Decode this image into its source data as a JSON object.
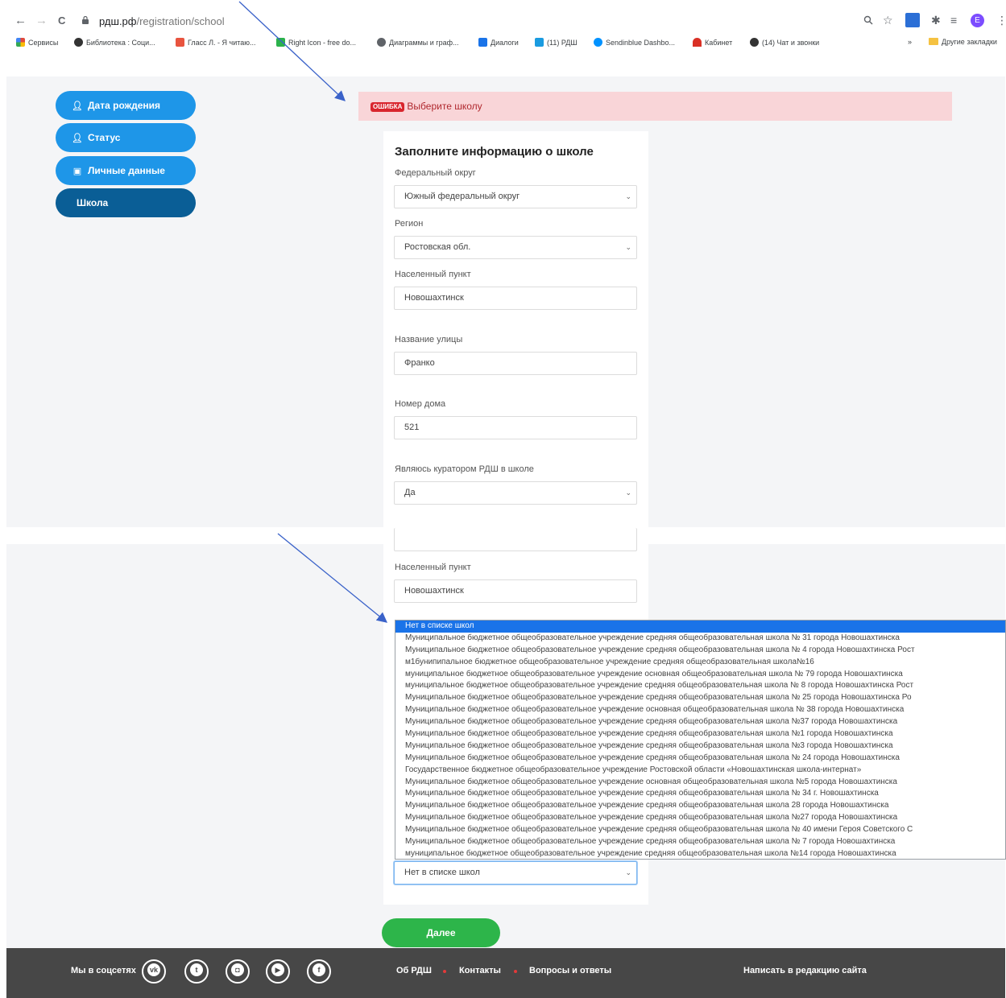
{
  "browser": {
    "back_label": "←",
    "forward_label": "→",
    "reload_label": "C",
    "url_host": "рдш.рф",
    "url_path": "/registration/school",
    "avatar_letter": "E",
    "bookmarks": [
      {
        "label": "Сервисы",
        "color": "#e24a3b"
      },
      {
        "label": "Библиотека : Соци...",
        "color": "#333333"
      },
      {
        "label": "Гласс Л. - Я читаю...",
        "color": "#e8543f"
      },
      {
        "label": "Right Icon - free do...",
        "color": "#2bb24c"
      },
      {
        "label": "Диаграммы и граф...",
        "color": "#5f6368"
      },
      {
        "label": "Диалоги",
        "color": "#1a73e8"
      },
      {
        "label": "(11) РДШ",
        "color": "#1a9be0"
      },
      {
        "label": "Sendinblue Dashbo...",
        "color": "#0092ff"
      },
      {
        "label": "Кабинет",
        "color": "#d93025"
      },
      {
        "label": "(14) Чат и звонки",
        "color": "#333333"
      }
    ],
    "bookmarks_more": "»",
    "other_bookmarks": "Другие закладки"
  },
  "sidebar": {
    "items": [
      {
        "label": "Дата рождения",
        "icon": "person-icon"
      },
      {
        "label": "Статус",
        "icon": "person-icon"
      },
      {
        "label": "Личные данные",
        "icon": "id-card-icon"
      },
      {
        "label": "Школа",
        "active": true
      }
    ]
  },
  "error": {
    "tag": "ОШИБКА",
    "message": "Выберите школу"
  },
  "form": {
    "title": "Заполните информацию о школе",
    "district_label": "Федеральный округ",
    "district_value": "Южный федеральный округ",
    "region_label": "Регион",
    "region_value": "Ростовская обл.",
    "city_label": "Населенный пункт",
    "city_value": "Новошахтинск",
    "street_label": "Название улицы",
    "street_value": "Франко",
    "house_label": "Номер дома",
    "house_value": "521",
    "curator_label": "Являюсь куратором РДШ в школе",
    "curator_value": "Да",
    "school_value": "Нет в списке школ",
    "next_label": "Далее"
  },
  "school_options": [
    "Нет в списке школ",
    "Муниципальное бюджетное общеобразовательное учреждение средняя общеобразовательная школа № 31 города Новошахтинска",
    "Муниципальное бюджетное общеобразовательное учреждение средняя общеобразовательная школа № 4 города Новошахтинска Рост",
    "м1бунипипальное бюджетное общеобразовательное учреждение средняя общеобразовательная школа№16",
    "муниципальное бюджетное общеобразовательное учреждение основная общеобразовательная школа № 79 города Новошахтинска",
    "муниципальное бюджетное общеобразовательное учреждение средняя общеобразовательная школа № 8 города Новошахтинска Рост",
    "Муниципальное бюджетное общеобразовательное учреждение средняя общеобразовательная школа № 25 города Новошахтинска Ро",
    "Муниципальное бюджетное общеобразовательное учреждение основная общеобразовательная школа № 38 города Новошахтинска",
    "Муниципальное бюджетное общеобразовательное учреждение средняя общеобразовательная школа №37 города Новошахтинска",
    "Муниципальное бюджетное общеобразовательное учреждение средняя общеобразовательная школа №1 города Новошахтинска",
    "Муниципальное бюджетное общеобразовательное учреждение средняя общеобразовательная школа №3 города Новошахтинска",
    "Муниципальное бюджетное общеобразовательное учреждение средняя общеобразовательная школа № 24 города Новошахтинска",
    "Государственное бюджетное общеобразовательное учреждение Ростовской области «Новошахтинская школа-интернат»",
    "Муниципальное бюджетное общеобразовательное учреждение основная общеобразовательная школа №5 города Новошахтинска",
    "Муниципальное бюджетное общеобразовательное учреждение средняя общеобразовательная школа № 34 г. Новошахтинска",
    "Муниципальное бюджетное общеобразовательное учреждение средняя общеобразовательная школа 28 города Новошахтинска",
    "Муниципальное бюджетное общеобразовательное учреждение средняя общеобразовательная школа №27 города Новошахтинска",
    "Муниципальное бюджетное общеобразовательное учреждение средняя общеобразовательная школа № 40 имени Героя Советского С",
    "Муниципальное бюджетное общеобразовательное учреждение средняя общеобразовательная школа № 7 города Новошахтинска",
    "муниципальное бюджетное общеобразовательное учреждение средняя общеобразовательная школа №14 города Новошахтинска"
  ],
  "footer": {
    "social_label": "Мы в соцсетях",
    "socials": [
      "vk-icon",
      "twitter-icon",
      "instagram-icon",
      "youtube-icon",
      "facebook-icon"
    ],
    "links": [
      "Об РДШ",
      "Контакты",
      "Вопросы и ответы"
    ],
    "write_label": "Написать в редакцию сайта"
  },
  "colors": {
    "sidebar_button": "#1e96e8",
    "sidebar_active": "#0a5e96",
    "error_bg": "#f9d5d8",
    "next_button": "#2db54a",
    "footer_bg": "#474747",
    "selected_option": "#1a73e8"
  }
}
